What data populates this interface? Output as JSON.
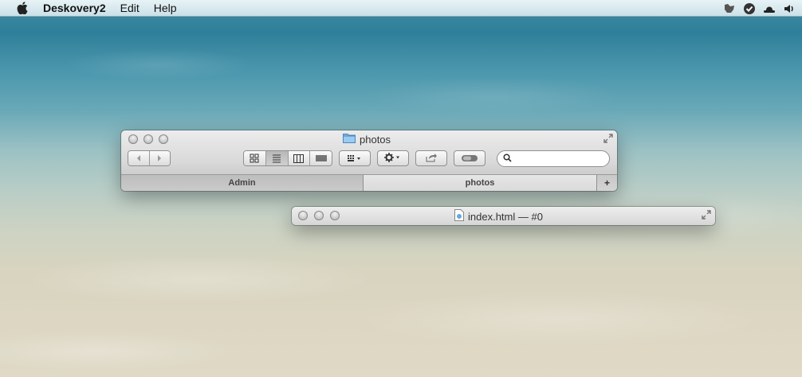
{
  "menubar": {
    "app_name": "Deskovery2",
    "items": [
      "Edit",
      "Help"
    ],
    "apple_icon": "apple-icon",
    "tray_icons": [
      "growl-icon",
      "checkmark-shield-icon",
      "hat-icon",
      "volume-icon"
    ]
  },
  "finder_window": {
    "title": "photos",
    "title_icon": "folder-icon",
    "toolbar": {
      "nav": [
        "back-arrow-icon",
        "forward-arrow-icon"
      ],
      "view_modes": [
        "icon-view",
        "list-view",
        "column-view",
        "coverflow-view"
      ],
      "active_view": "list-view",
      "arrange_icon": "arrange-grid-icon",
      "action_icon": "gear-icon",
      "share_icon": "share-icon",
      "toggle_icon": "toggle-pill-icon",
      "search_placeholder": ""
    },
    "tabs": [
      {
        "label": "Admin"
      },
      {
        "label": "photos"
      }
    ],
    "add_tab_label": "+"
  },
  "doc_window": {
    "title": "index.html — #0",
    "title_icon": "html-document-icon"
  }
}
